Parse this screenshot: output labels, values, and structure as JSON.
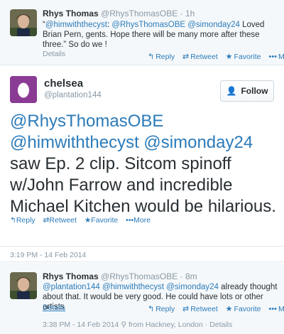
{
  "top_tweet": {
    "fullname": "Rhys Thomas",
    "handle": "@RhysThomasOBE",
    "time": "1h",
    "text_quote_open": "“",
    "mention1": "@himwiththecyst",
    "text_colon": ": ",
    "mention2": "@RhysThomasOBE",
    "mention3": "@simonday24",
    "text_body": " Loved Brian Pern, gents. Hope there will be many more after these three.” So do we !",
    "details": "Details",
    "actions": {
      "reply": "Reply",
      "retweet": "Retweet",
      "favorite": "Favorite",
      "more": "More"
    }
  },
  "main_tweet": {
    "fullname": "chelsea",
    "handle": "@plantation144",
    "follow_label": "Follow",
    "mention1": "@RhysThomasOBE",
    "mention2": "@himwiththecyst",
    "mention3": "@simonday24",
    "text_body": "saw Ep. 2 clip.  Sitcom spinoff w/John Farrow and incredible Michael Kitchen would be hilarious.",
    "actions": {
      "reply": "Reply",
      "retweet": "Retweet",
      "favorite": "Favorite",
      "more": "More"
    },
    "timestamp": "3:19 PM - 14 Feb 2014"
  },
  "reply_tweet": {
    "fullname": "Rhys Thomas",
    "handle": "@RhysThomasOBE",
    "time": "8m",
    "mention1": "@plantation144",
    "mention2": "@himwiththecyst",
    "mention3": "@simonday24",
    "text_body": " already thought about that. It would be very good. He could have lots or other artists",
    "details": "Details",
    "actions": {
      "reply": "Reply",
      "retweet": "Retweet",
      "favorite": "Favorite",
      "more": "More"
    },
    "timestamp": "3:38 PM - 14 Feb 2014",
    "location": "from Hackney, London",
    "details2": "Details"
  },
  "colors": {
    "link": "#2b7bb9",
    "muted": "#8899a6",
    "text": "#292f33",
    "egg_bg": "#8a3c95"
  },
  "icons": {
    "reply": "reply-arrow-icon",
    "retweet": "retweet-icon",
    "favorite": "star-icon",
    "more": "more-dots-icon",
    "follow": "add-user-icon",
    "location": "location-pin-icon"
  }
}
